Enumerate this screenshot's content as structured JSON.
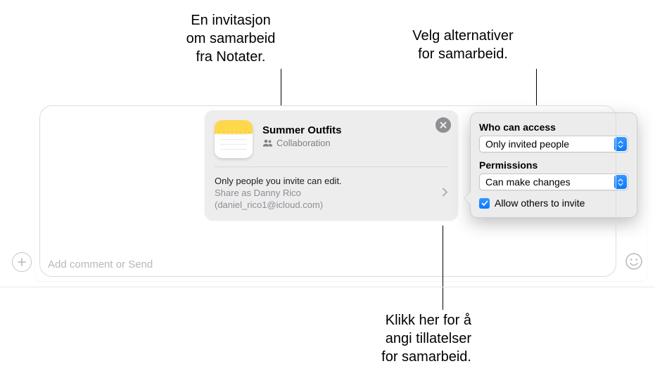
{
  "callouts": {
    "top_left": "En invitasjon\nom samarbeid\nfra Notater.",
    "top_right": "Velg alternativer\nfor samarbeid.",
    "bottom": "Klikk her for å\nangi tillatelser\nfor samarbeid."
  },
  "invite": {
    "title": "Summer Outfits",
    "collab_label": "Collaboration",
    "info_line1": "Only people you invite can edit.",
    "info_line2": "Share as Danny Rico",
    "info_line3": "(daniel_rico1@icloud.com)"
  },
  "popover": {
    "access_label": "Who can access",
    "access_value": "Only invited people",
    "perm_label": "Permissions",
    "perm_value": "Can make changes",
    "allow_invite": "Allow others to invite",
    "allow_invite_checked": true
  },
  "input": {
    "placeholder": "Add comment or Send"
  }
}
